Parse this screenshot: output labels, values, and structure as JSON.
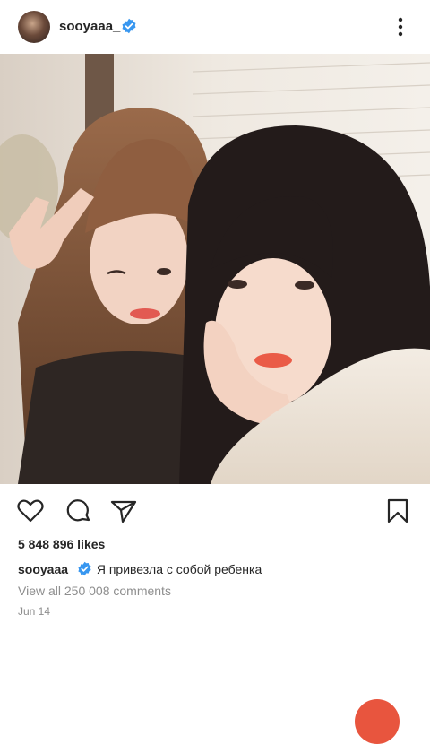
{
  "post": {
    "username": "sooyaaa_",
    "verified": true,
    "likes": "5 848 896 likes",
    "caption": "Я привезла с собой ребенка",
    "comments_link": "View all 250 008 comments",
    "date": "Jun 14"
  },
  "colors": {
    "verified_blue": "#3897f0",
    "text": "#262626",
    "muted": "#8e8e8e",
    "fab": "#e8553e"
  },
  "icons": {
    "more": "more-vertical-icon",
    "like": "heart-icon",
    "comment": "comment-icon",
    "share": "paper-plane-icon",
    "save": "bookmark-icon"
  }
}
